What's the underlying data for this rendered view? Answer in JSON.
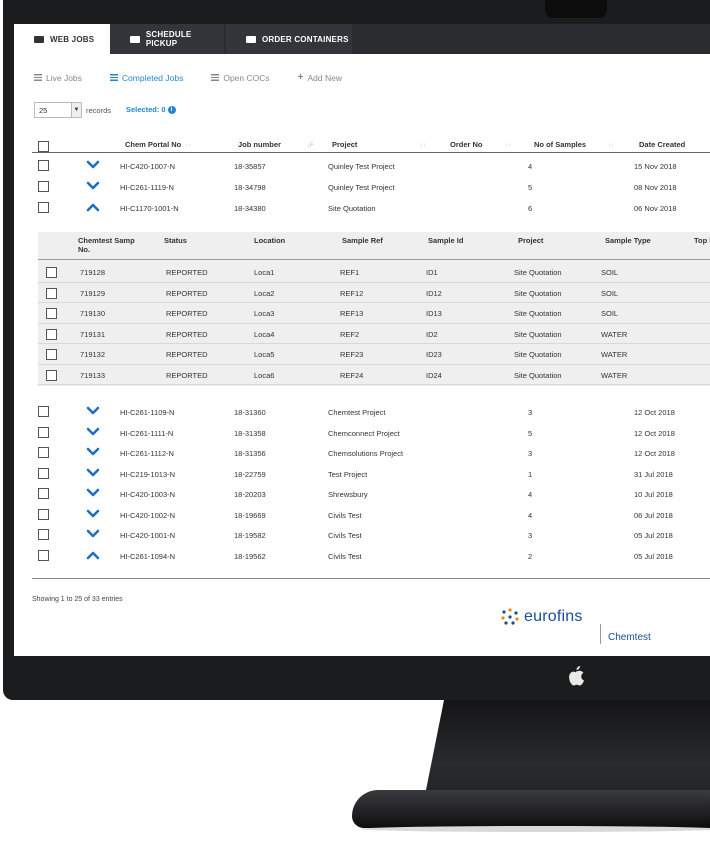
{
  "tabs": [
    {
      "label": "WEB JOBS",
      "icon": "briefcase-icon"
    },
    {
      "label": "SCHEDULE PICKUP",
      "icon": "truck-icon"
    },
    {
      "label": "ORDER CONTAINERS",
      "icon": "folder-icon"
    }
  ],
  "subnav": [
    {
      "label": "Live Jobs",
      "icon": "list-icon"
    },
    {
      "label": "Completed Jobs",
      "icon": "list-icon"
    },
    {
      "label": "Open COCs",
      "icon": "list-icon"
    },
    {
      "label": "Add New",
      "icon": "plus-icon"
    }
  ],
  "records": {
    "value": "25",
    "label": "records"
  },
  "selected": {
    "label": "Selected: 0"
  },
  "jobs_table": {
    "headers": [
      "Chem Portal No",
      "Job number",
      "Project",
      "Order No",
      "No of Samples",
      "Date Created"
    ],
    "rows_top": [
      {
        "portal": "HI-C420-1007-N",
        "job": "18-35857",
        "project": "Quinley Test Project",
        "samples": "4",
        "date": "15 Nov 2018",
        "expanded": false
      },
      {
        "portal": "HI-C261-1119-N",
        "job": "18-34798",
        "project": "Quinley Test Project",
        "samples": "5",
        "date": "08 Nov 2018",
        "expanded": false
      },
      {
        "portal": "HI-C1170-1001-N",
        "job": "18-34380",
        "project": "Site Quotation",
        "samples": "6",
        "date": "06 Nov 2018",
        "expanded": true
      }
    ],
    "rows_bottom": [
      {
        "portal": "HI-C261-1109-N",
        "job": "18-31360",
        "project": "Chemtest Project",
        "samples": "3",
        "date": "12 Oct 2018",
        "expanded": false
      },
      {
        "portal": "HI-C261-1111-N",
        "job": "18-31358",
        "project": "Chemconnect Project",
        "samples": "5",
        "date": "12 Oct 2018",
        "expanded": false
      },
      {
        "portal": "HI-C261-1112-N",
        "job": "18-31356",
        "project": "Chemsolutions Project",
        "samples": "3",
        "date": "12 Oct 2018",
        "expanded": false
      },
      {
        "portal": "HI-C219-1013-N",
        "job": "18-22759",
        "project": "Test Project",
        "samples": "1",
        "date": "31 Jul 2018",
        "expanded": false
      },
      {
        "portal": "HI-C420-1003-N",
        "job": "18-20203",
        "project": "Shrewsbury",
        "samples": "4",
        "date": "10 Jul 2018",
        "expanded": false
      },
      {
        "portal": "HI-C420-1002-N",
        "job": "18-19669",
        "project": "Civils Test",
        "samples": "4",
        "date": "06 Jul 2018",
        "expanded": false
      },
      {
        "portal": "HI-C420-1001-N",
        "job": "18-19582",
        "project": "Civils Test",
        "samples": "3",
        "date": "05 Jul 2018",
        "expanded": false
      },
      {
        "portal": "HI-C261-1094-N",
        "job": "18-19562",
        "project": "Civils Test",
        "samples": "2",
        "date": "05 Jul 2018",
        "expanded": true
      }
    ]
  },
  "samples_table": {
    "headers": {
      "samp_line1": "Chemtest Samp",
      "samp_line2": "No.",
      "status": "Status",
      "location": "Location",
      "ref": "Sample Ref",
      "id": "Sample Id",
      "project": "Project",
      "type": "Sample Type",
      "top": "Top I"
    },
    "rows": [
      {
        "samp": "719128",
        "status": "REPORTED",
        "location": "Loca1",
        "ref": "REF1",
        "id": "ID1",
        "project": "Site Quotation",
        "type": "SOIL"
      },
      {
        "samp": "719129",
        "status": "REPORTED",
        "location": "Loca2",
        "ref": "REF12",
        "id": "ID12",
        "project": "Site Quotation",
        "type": "SOIL"
      },
      {
        "samp": "719130",
        "status": "REPORTED",
        "location": "Loca3",
        "ref": "REF13",
        "id": "ID13",
        "project": "Site Quotation",
        "type": "SOIL"
      },
      {
        "samp": "719131",
        "status": "REPORTED",
        "location": "Loca4",
        "ref": "REF2",
        "id": "ID2",
        "project": "Site Quotation",
        "type": "WATER"
      },
      {
        "samp": "719132",
        "status": "REPORTED",
        "location": "Loca5",
        "ref": "REF23",
        "id": "ID23",
        "project": "Site Quotation",
        "type": "WATER"
      },
      {
        "samp": "719133",
        "status": "REPORTED",
        "location": "Loca6",
        "ref": "REF24",
        "id": "ID24",
        "project": "Site Quotation",
        "type": "WATER"
      }
    ]
  },
  "footer": {
    "entries": "Showing 1 to 25 of 33 entries"
  },
  "brand": {
    "name": "eurofins",
    "sub": "Chemtest"
  },
  "colors": {
    "accent": "#1e88d4",
    "tabbar": "#2a2c30",
    "brand": "#1a4c9a"
  }
}
